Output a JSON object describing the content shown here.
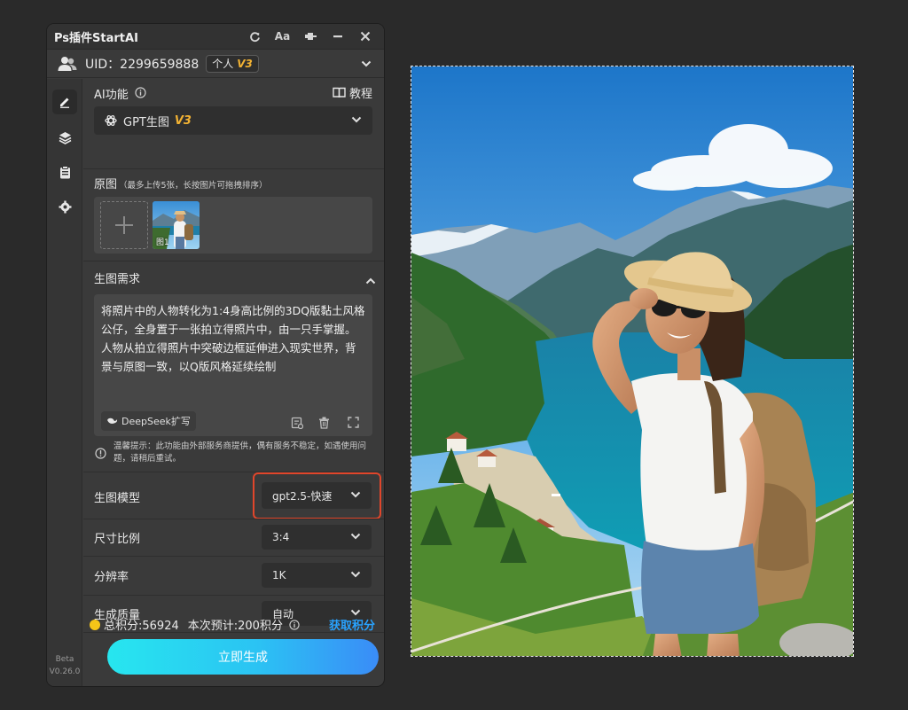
{
  "window": {
    "title": "Ps插件StartAI",
    "icons": [
      "refresh-icon",
      "font-size-icon",
      "pin-icon",
      "minimize-icon",
      "close-icon"
    ],
    "font_button_label": "Aa"
  },
  "account": {
    "uid_text": "UID：2299659888",
    "tag_label": "个人",
    "tag_version": "V3"
  },
  "sidebar": {
    "icons": [
      "edit-icon",
      "layers-icon",
      "clipboard-icon",
      "settings-icon"
    ],
    "beta_label": "Beta",
    "version": "V0.26.0"
  },
  "ai_function": {
    "label": "AI功能",
    "tutorial_label": "教程",
    "selected": "GPT生图",
    "selected_version": "V3"
  },
  "source_image": {
    "label": "原图",
    "hint": "（最多上传5张，长按图片可拖拽排序）",
    "thumb_label": "图1"
  },
  "prompt": {
    "section_label": "生图需求",
    "text": "将照片中的人物转化为1:4身高比例的3DQ版黏土风格公仔，全身置于一张拍立得照片中，由一只手掌握。人物从拍立得照片中突破边框延伸进入现实世界，背景与原图一致，以Q版风格延续绘制",
    "deepseek_label": "DeepSeek扩写",
    "notice": "温馨提示：此功能由外部服务商提供，偶有服务不稳定，如遇使用问题，请稍后重试。"
  },
  "settings": {
    "model_label": "生图模型",
    "model_value": "gpt2.5-快速",
    "ratio_label": "尺寸比例",
    "ratio_value": "3:4",
    "resolution_label": "分辨率",
    "resolution_value": "1K",
    "quality_label": "生成质量",
    "quality_value": "自动"
  },
  "footer": {
    "total_credits": "总积分:56924",
    "estimate": "本次预计:200积分",
    "get_credits": "获取积分",
    "generate_label": "立即生成"
  },
  "colors": {
    "accent_version": "#f2b233",
    "highlight_border": "#e0462b",
    "generate_gradient_start": "#27e6ef",
    "generate_gradient_end": "#3a8cf7",
    "link": "#29a3ff"
  }
}
